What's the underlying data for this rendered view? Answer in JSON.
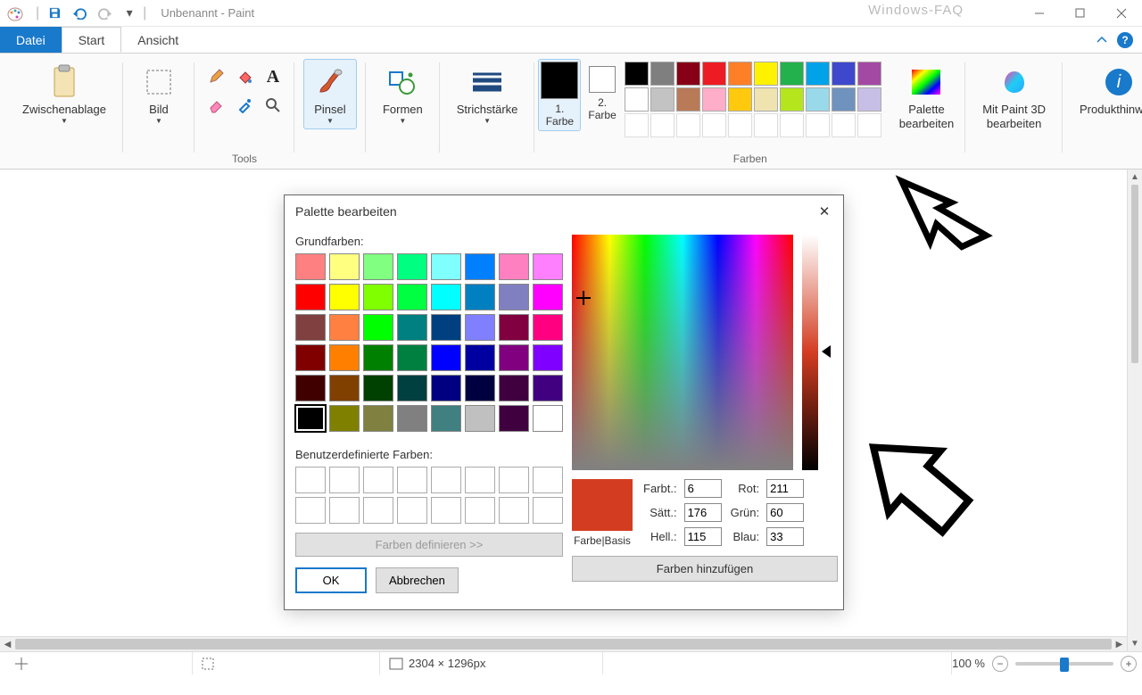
{
  "title_bar": {
    "doc_name": "Unbenannt",
    "app_name": "Paint",
    "watermark": "Windows-FAQ"
  },
  "tabs": {
    "file": "Datei",
    "start": "Start",
    "view": "Ansicht"
  },
  "ribbon": {
    "clipboard": {
      "label": "Zwischenablage",
      "group_label": ""
    },
    "image": {
      "label": "Bild"
    },
    "tools_group_label": "Tools",
    "brushes": {
      "label": "Pinsel"
    },
    "shapes": {
      "label": "Formen"
    },
    "stroke": {
      "label": "Strichstärke"
    },
    "color1": {
      "label": "1.\nFarbe"
    },
    "color2": {
      "label": "2.\nFarbe"
    },
    "colors_group_label": "Farben",
    "edit_palette": {
      "label": "Palette\nbearbeiten"
    },
    "paint3d": {
      "label": "Mit Paint 3D\nbearbeiten"
    },
    "product_info": {
      "label": "Produkthinweis"
    },
    "swatches_row1": [
      "#000000",
      "#7f7f7f",
      "#880015",
      "#ed1c24",
      "#ff7f27",
      "#fff200",
      "#22b14c",
      "#00a2e8",
      "#3f48cc",
      "#a349a4"
    ],
    "swatches_row2": [
      "#ffffff",
      "#c3c3c3",
      "#b97a57",
      "#ffaec9",
      "#ffc90e",
      "#efe4b0",
      "#b5e61d",
      "#99d9ea",
      "#7092be",
      "#c8bfe7"
    ],
    "swatches_row3": [
      "",
      "",
      "",
      "",
      "",
      "",
      "",
      "",
      "",
      ""
    ]
  },
  "status": {
    "dimensions": "2304 × 1296px",
    "zoom": "100 %"
  },
  "dialog": {
    "title": "Palette bearbeiten",
    "basic_label": "Grundfarben:",
    "custom_label": "Benutzerdefinierte Farben:",
    "define_btn": "Farben definieren >>",
    "ok": "OK",
    "cancel": "Abbrechen",
    "preview_label": "Farbe|Basis",
    "hue_label": "Farbt.:",
    "sat_label": "Sätt.:",
    "lum_label": "Hell.:",
    "red_label": "Rot:",
    "green_label": "Grün:",
    "blue_label": "Blau:",
    "hue": "6",
    "sat": "176",
    "lum": "115",
    "red": "211",
    "green": "60",
    "blue": "33",
    "add_btn": "Farben hinzufügen",
    "basic_colors": [
      "#ff8080",
      "#ffff80",
      "#80ff80",
      "#00ff80",
      "#80ffff",
      "#0080ff",
      "#ff80c0",
      "#ff80ff",
      "#ff0000",
      "#ffff00",
      "#80ff00",
      "#00ff40",
      "#00ffff",
      "#0080c0",
      "#8080c0",
      "#ff00ff",
      "#804040",
      "#ff8040",
      "#00ff00",
      "#008080",
      "#004080",
      "#8080ff",
      "#800040",
      "#ff0080",
      "#800000",
      "#ff8000",
      "#008000",
      "#008040",
      "#0000ff",
      "#0000a0",
      "#800080",
      "#8000ff",
      "#400000",
      "#804000",
      "#004000",
      "#004040",
      "#000080",
      "#000040",
      "#400040",
      "#400080",
      "#000000",
      "#808000",
      "#808040",
      "#808080",
      "#408080",
      "#c0c0c0",
      "#400040",
      "#ffffff"
    ],
    "selected_index": 40
  }
}
